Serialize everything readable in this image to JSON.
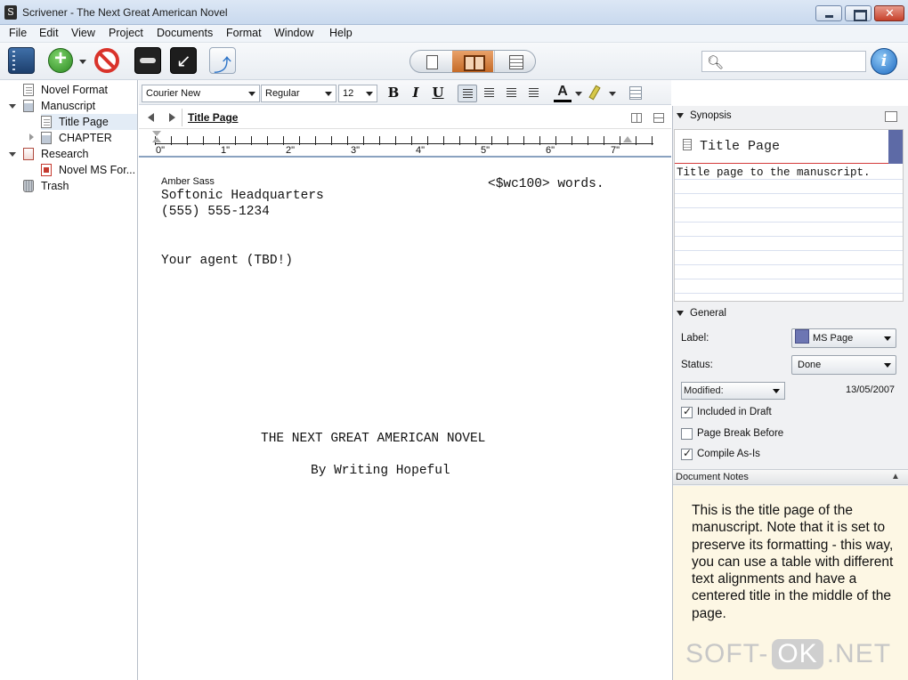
{
  "window": {
    "title": "Scrivener - The Next Great American Novel"
  },
  "menu": [
    "File",
    "Edit",
    "View",
    "Project",
    "Documents",
    "Format",
    "Window",
    "Help"
  ],
  "search": {
    "placeholder": ""
  },
  "binder": {
    "items": [
      {
        "label": "Novel Format",
        "icon": "document-icon"
      },
      {
        "label": "Manuscript",
        "icon": "folder-icon"
      },
      {
        "label": "Title Page",
        "icon": "document-icon",
        "selected": true
      },
      {
        "label": "CHAPTER",
        "icon": "folder-icon"
      },
      {
        "label": "Research",
        "icon": "research-folder-icon"
      },
      {
        "label": "Novel MS For...",
        "icon": "pdf-icon"
      },
      {
        "label": "Trash",
        "icon": "trash-icon"
      }
    ]
  },
  "format_bar": {
    "font": "Courier New",
    "style": "Regular",
    "size": "12",
    "bold": "B",
    "italic": "I",
    "underline": "U",
    "text_color": "A"
  },
  "editor": {
    "header_title": "Title Page",
    "ruler_numbers": [
      "0\"",
      "1\"",
      "2\"",
      "3\"",
      "4\"",
      "5\"",
      "6\"",
      "7\""
    ],
    "author": "Amber Sass",
    "word_count": "<$wc100> words.",
    "address_line1": "Softonic Headquarters",
    "address_line2": "(555) 555-1234",
    "agent": "Your agent (TBD!)",
    "book_title": "THE NEXT GREAT AMERICAN NOVEL",
    "byline": "By Writing Hopeful"
  },
  "inspector": {
    "synopsis_label": "Synopsis",
    "synopsis_title": "Title Page",
    "synopsis_text": "Title page to the manuscript.",
    "general_label": "General",
    "label_label": "Label:",
    "label_value": "MS Page",
    "label_color": "#6d76b3",
    "status_label": "Status:",
    "status_value": "Done",
    "modified_label": "Modified:",
    "modified_date": "13/05/2007",
    "included_in_draft": "Included in Draft",
    "page_break_before": "Page Break Before",
    "compile_as_is": "Compile As-Is",
    "notes_label": "Document Notes",
    "notes_text": "This is the title page of the manuscript. Note that it is set to preserve its formatting - this way, you can use a table with different text alignments and have a centered title in the middle of the page."
  },
  "watermark": {
    "left": "SOFT-",
    "ok": "OK",
    "right": ".NET"
  }
}
